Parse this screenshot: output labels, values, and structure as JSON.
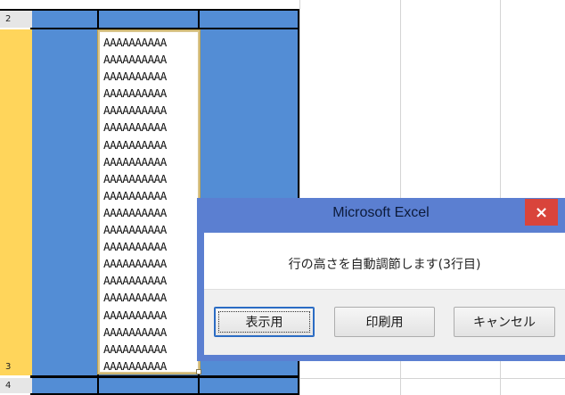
{
  "rows": {
    "header_2": "2",
    "header_3": "3",
    "header_4": "4"
  },
  "cell": {
    "text_lines": [
      "AAAAAAAAAA",
      "AAAAAAAAAA",
      "AAAAAAAAAA",
      "AAAAAAAAAA",
      "AAAAAAAAAA",
      "AAAAAAAAAA",
      "AAAAAAAAAA",
      "AAAAAAAAAA",
      "AAAAAAAAAA",
      "AAAAAAAAAA",
      "AAAAAAAAAA",
      "AAAAAAAAAA",
      "AAAAAAAAAA",
      "AAAAAAAAAA",
      "AAAAAAAAAA",
      "AAAAAAAAAA",
      "AAAAAAAAAA",
      "AAAAAAAAAA",
      "AAAAAAAAAA",
      "AAAAAAAAAA"
    ]
  },
  "dialog": {
    "title": "Microsoft Excel",
    "close_label": "×",
    "message": "行の高さを自動調節します(3行目)",
    "buttons": {
      "display": "表示用",
      "print": "印刷用",
      "cancel": "キャンセル"
    }
  },
  "colors": {
    "row_fill": "#538dd5",
    "selected_header": "#ffd55b",
    "dialog_frame": "#5b7fd1",
    "close_button": "#d9443b"
  }
}
